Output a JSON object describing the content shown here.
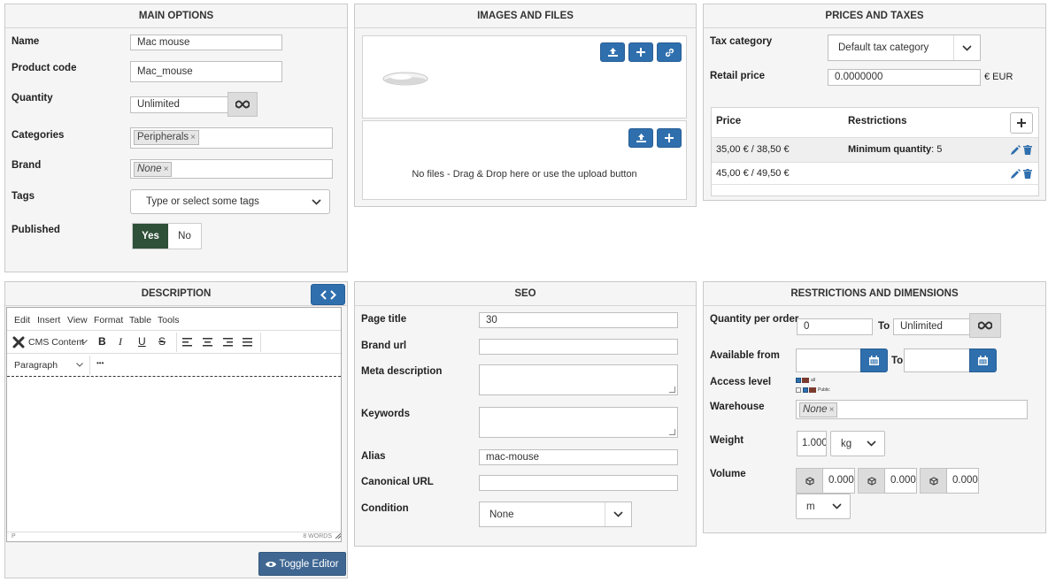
{
  "main_options": {
    "title": "MAIN OPTIONS",
    "name_label": "Name",
    "name_value": "Mac mouse",
    "code_label": "Product code",
    "code_value": "Mac_mouse",
    "quantity_label": "Quantity",
    "quantity_value": "Unlimited",
    "categories_label": "Categories",
    "category_chip": "Peripherals",
    "brand_label": "Brand",
    "brand_chip": "None",
    "tags_label": "Tags",
    "tags_placeholder": "Type or select some tags",
    "published_label": "Published",
    "yes": "Yes",
    "no": "No"
  },
  "images_files": {
    "title": "IMAGES AND FILES",
    "no_files": "No files - Drag & Drop here or use the upload button"
  },
  "prices_taxes": {
    "title": "PRICES AND TAXES",
    "tax_label": "Tax category",
    "tax_value": "Default tax category",
    "retail_label": "Retail price",
    "retail_value": "0.0000000",
    "currency": "€ EUR",
    "col_price": "Price",
    "col_restrictions": "Restrictions",
    "rows": [
      {
        "price": "35,00 € / 38,50 €",
        "restriction_label": "Minimum quantity",
        "restriction_value": ": 5"
      },
      {
        "price": "45,00 € / 49,50 €",
        "restriction_label": "",
        "restriction_value": ""
      }
    ]
  },
  "description": {
    "title": "DESCRIPTION",
    "menu": [
      "Edit",
      "Insert",
      "View",
      "Format",
      "Table",
      "Tools"
    ],
    "cms_content": "CMS Content",
    "paragraph": "Paragraph",
    "more": "•••",
    "status_path": "P",
    "word_count": "8 WORDS",
    "toggle_editor": "Toggle Editor"
  },
  "seo": {
    "title": "SEO",
    "page_title_label": "Page title",
    "page_title_value": "30",
    "brand_url_label": "Brand url",
    "meta_label": "Meta description",
    "keywords_label": "Keywords",
    "alias_label": "Alias",
    "alias_value": "mac-mouse",
    "canonical_label": "Canonical URL",
    "condition_label": "Condition",
    "condition_value": "None"
  },
  "restrictions": {
    "title": "RESTRICTIONS AND DIMENSIONS",
    "qty_label": "Quantity per order",
    "qty_from": "0",
    "to": "To",
    "qty_to": "Unlimited",
    "available_label": "Available from",
    "access_label": "Access level",
    "access_all": "all",
    "access_public": "Public",
    "warehouse_label": "Warehouse",
    "warehouse_chip": "None",
    "weight_label": "Weight",
    "weight_value": "1.000",
    "weight_unit": "kg",
    "volume_label": "Volume",
    "vol1": "0.000",
    "vol2": "0.000",
    "vol3": "0.000",
    "volume_unit": "m"
  },
  "colors": {
    "primary_button": "#2f6fad",
    "dark_button": "#3f6792",
    "published_yes": "#2e4f38"
  }
}
